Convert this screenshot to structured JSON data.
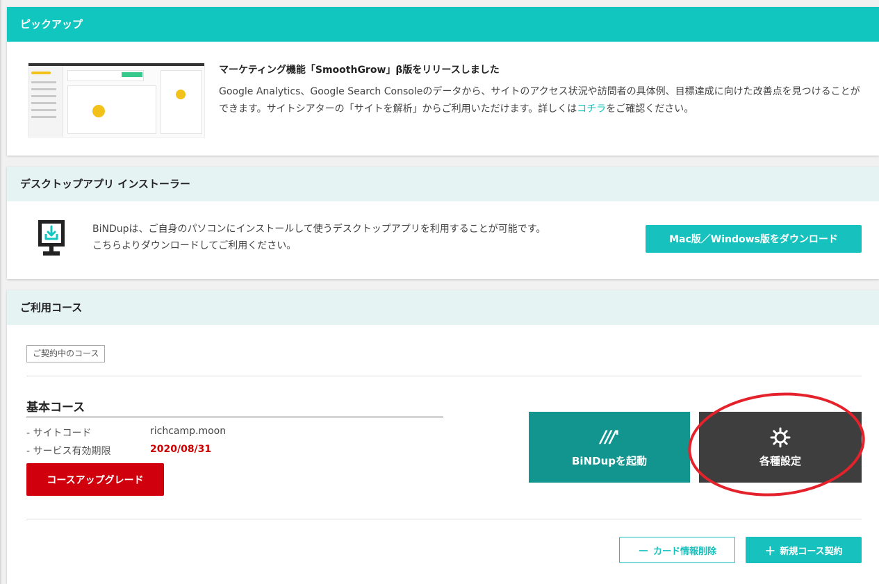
{
  "pickup": {
    "header": "ピックアップ",
    "title": "マーケティング機能「SmoothGrow」β版をリリースしました",
    "body_before_link": "Google Analytics、Google Search Consoleのデータから、サイトのアクセス状況や訪問者の具体例、目標達成に向けた改善点を見つけることができます。サイトシアターの「サイトを解析」からご利用いただけます。詳しくは",
    "link_text": "コチラ",
    "body_after_link": "をご確認ください。",
    "thumbnail_icon": "smoothgrow-screenshot-thumbnail"
  },
  "installer": {
    "header": "デスクトップアプリ インストーラー",
    "line1": "BiNDupは、ご自身のパソコンにインストールして使うデスクトップアプリを利用することが可能です。",
    "line2": "こちらよりダウンロードしてご利用ください。",
    "download_button": "Mac版／Windows版をダウンロード",
    "icon": "monitor-download-icon",
    "icon_color": "#12c6c0"
  },
  "course": {
    "header": "ご利用コース",
    "tag": "ご契約中のコース",
    "name": "基本コース",
    "site_code_label": "- サイトコード",
    "site_code_value": "richcamp.moon",
    "expiry_label": "- サービス有効期限",
    "expiry_value": "2020/08/31",
    "upgrade_button": "コースアップグレード",
    "launch_logo": "///'",
    "launch_button": "BiNDupを起動",
    "settings_icon": "gear-icon",
    "settings_button": "各種設定",
    "card_delete_symbol": "－",
    "card_delete_button": "カード情報削除",
    "new_course_symbol": "＋",
    "new_course_button": "新規コース契約"
  },
  "colors": {
    "accent": "#12c6c0",
    "launch": "#12958f",
    "settings": "#3e3e3e",
    "upgrade": "#d0000d",
    "highlight": "#e4222b"
  }
}
